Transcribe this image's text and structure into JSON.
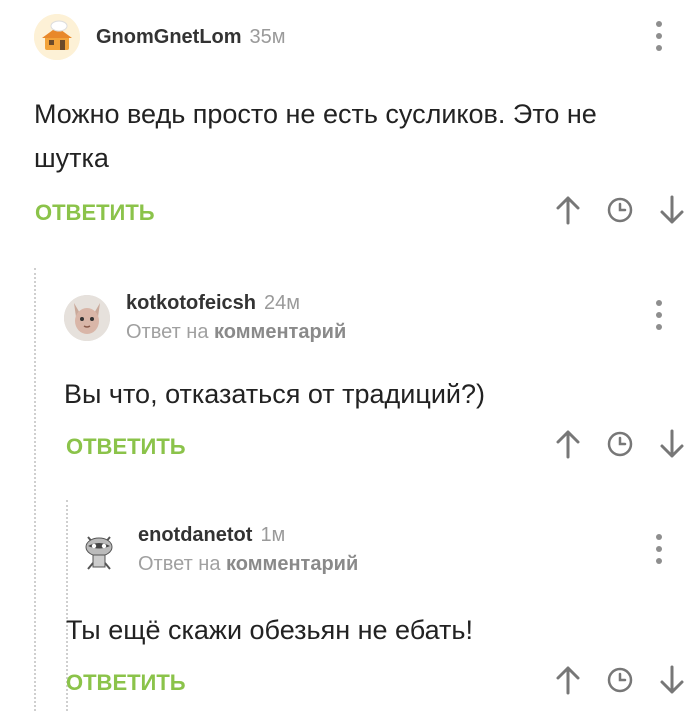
{
  "comments": [
    {
      "username": "GnomGnetLom",
      "time": "35м",
      "reply_to": null,
      "text": "Можно ведь просто не есть сусликов. Это не шутка",
      "reply_label": "ОТВЕТИТЬ"
    },
    {
      "username": "kotkotofeicsh",
      "time": "24м",
      "reply_to_prefix": "Ответ на",
      "reply_to_target": "комментарий",
      "text": "Вы что, отказаться от традиций?)",
      "reply_label": "ОТВЕТИТЬ"
    },
    {
      "username": "enotdanetot",
      "time": "1м",
      "reply_to_prefix": "Ответ на",
      "reply_to_target": "комментарий",
      "text": "Ты ещё скажи обезьян не ебать!",
      "reply_label": "ОТВЕТИТЬ"
    }
  ],
  "icons": {
    "upvote": "arrow-up-icon",
    "history": "clock-icon",
    "downvote": "arrow-down-icon",
    "menu": "more-vertical-icon"
  },
  "colors": {
    "accent_green": "#8bc34a",
    "muted_gray": "#9a9a9a",
    "icon_gray": "#8e8e8e"
  }
}
